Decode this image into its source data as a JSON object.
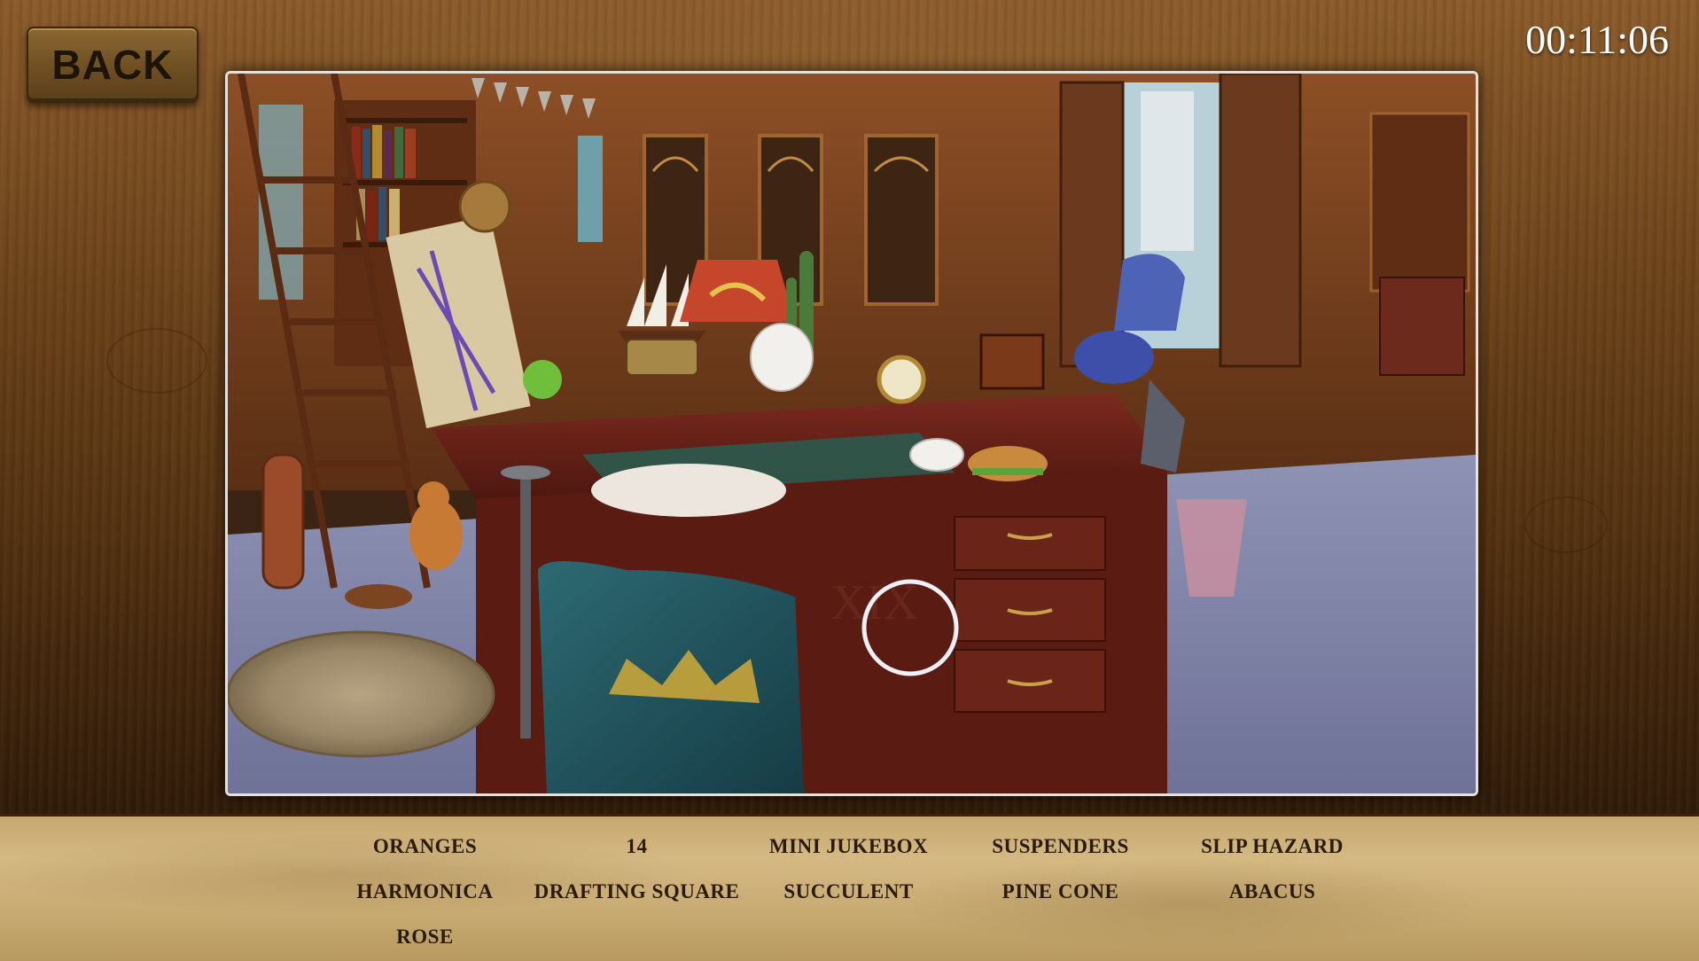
{
  "back_button": {
    "label": "BACK"
  },
  "timer": {
    "value": "00:11:06"
  },
  "scene": {
    "roman_numeral": "XIX"
  },
  "word_list": {
    "items": [
      "ORANGES",
      "14",
      "MINI JUKEBOX",
      "SUSPENDERS",
      "SLIP HAZARD",
      "HARMONICA",
      "DRAFTING SQUARE",
      "SUCCULENT",
      "PINE CONE",
      "ABACUS",
      "ROSE"
    ]
  },
  "colors": {
    "wood": "#6b4219",
    "word_bar": "#d5b983",
    "frame_border": "#e6e0dc",
    "timer_text": "#ffffff",
    "word_text": "#2a1b0a"
  }
}
